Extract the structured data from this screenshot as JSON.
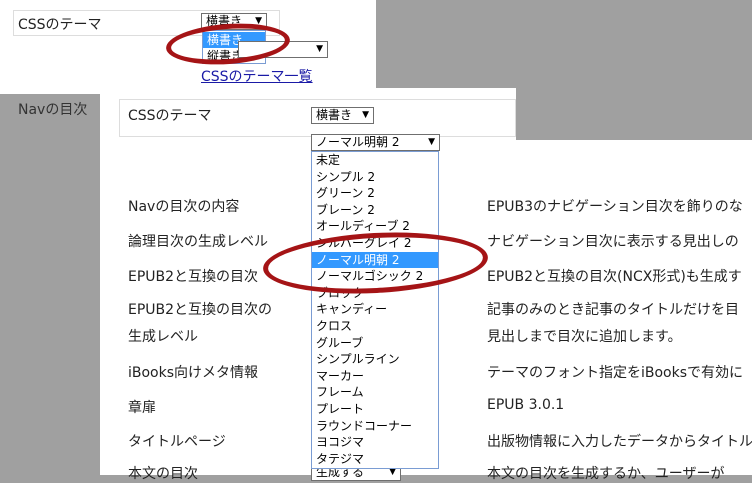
{
  "back_panel": {
    "css_label": "CSSのテーマ",
    "select_value": "横書き",
    "options": [
      "横書き",
      "縦書き"
    ],
    "selected_index": 0,
    "link": "CSSのテーマ一覧",
    "nav_label_partial": "Navの目次"
  },
  "front_panel": {
    "css_label": "CSSのテーマ",
    "writing_select": "横書き",
    "theme_select": "ノーマル明朝 2",
    "theme_options": [
      "未定",
      "シンプル 2",
      "グリーン 2",
      "ブレーン 2",
      "オールディーブ 2",
      "シルバーグレイ 2",
      "ノーマル明朝 2",
      "ノーマルゴシック 2",
      "ブロック",
      "キャンディー",
      "クロス",
      "グルーブ",
      "シンプルライン",
      "マーカー",
      "フレーム",
      "プレート",
      "ラウンドコーナー",
      "ヨコジマ",
      "タテジマ"
    ],
    "selected_theme_index": 6,
    "settings": [
      {
        "label": "Navの目次の内容",
        "value": "EPUB3のナビゲーション目次を飾りのな"
      },
      {
        "label": "論理目次の生成レベル",
        "value": "ナビゲーション目次に表示する見出しの"
      },
      {
        "label": "EPUB2と互換の目次",
        "value": "EPUB2と互換の目次(NCX形式)も生成す"
      },
      {
        "label": "EPUB2と互換の目次の",
        "value": "記事のみのとき記事のタイトルだけを目"
      },
      {
        "label": "生成レベル",
        "value": "見出しまで目次に追加します。"
      },
      {
        "label": "iBooks向けメタ情報",
        "value": "テーマのフォント指定をiBooksで有効に"
      },
      {
        "label": "章扉",
        "value": "EPUB 3.0.1"
      },
      {
        "label": "タイトルページ",
        "value": "出版物情報に入力したデータからタイトル"
      },
      {
        "label": "本文の目次",
        "value": "本文の目次を生成するか、ユーザーが"
      }
    ],
    "bottom_select": "生成する"
  },
  "colors": {
    "highlight": "#3399ff",
    "annotation": "#a51416",
    "backdrop": "#a0a0a0"
  }
}
